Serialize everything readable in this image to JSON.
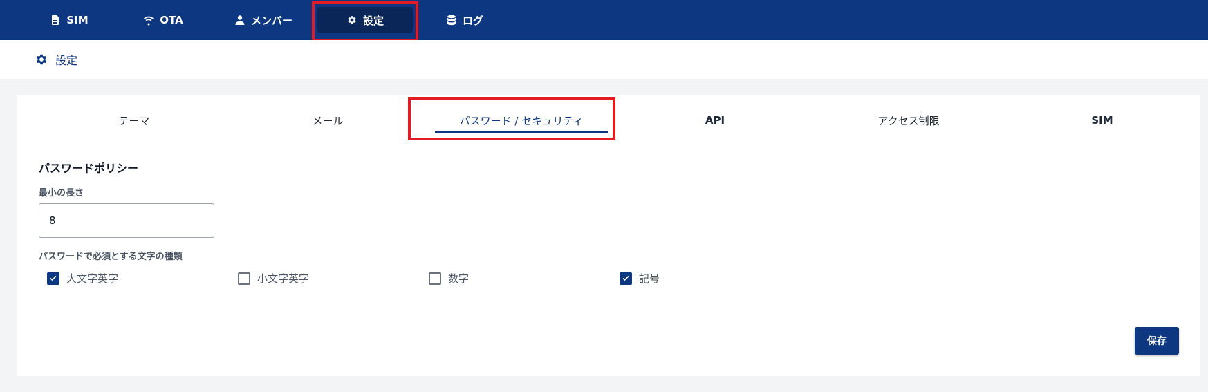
{
  "nav": {
    "items": [
      {
        "label": "SIM",
        "icon": "sim-card-icon"
      },
      {
        "label": "OTA",
        "icon": "wifi-icon"
      },
      {
        "label": "メンバー",
        "icon": "user-icon"
      },
      {
        "label": "設定",
        "icon": "gear-icon",
        "active": true
      },
      {
        "label": "ログ",
        "icon": "database-icon"
      }
    ]
  },
  "page": {
    "title": "設定",
    "icon": "gear-icon"
  },
  "tabs": [
    {
      "label": "テーマ"
    },
    {
      "label": "メール"
    },
    {
      "label": "パスワード / セキュリティ",
      "active": true
    },
    {
      "label": "API"
    },
    {
      "label": "アクセス制限"
    },
    {
      "label": "SIM"
    }
  ],
  "policy": {
    "title": "パスワードポリシー",
    "min_length_label": "最小の長さ",
    "min_length_value": "8",
    "required_types_label": "パスワードで必須とする文字の種類",
    "options": [
      {
        "label": "大文字英字",
        "checked": true
      },
      {
        "label": "小文字英字",
        "checked": false
      },
      {
        "label": "数字",
        "checked": false
      },
      {
        "label": "記号",
        "checked": true
      }
    ],
    "save_label": "保存"
  },
  "colors": {
    "brand": "#0d3780",
    "highlight": "#e31b23"
  }
}
